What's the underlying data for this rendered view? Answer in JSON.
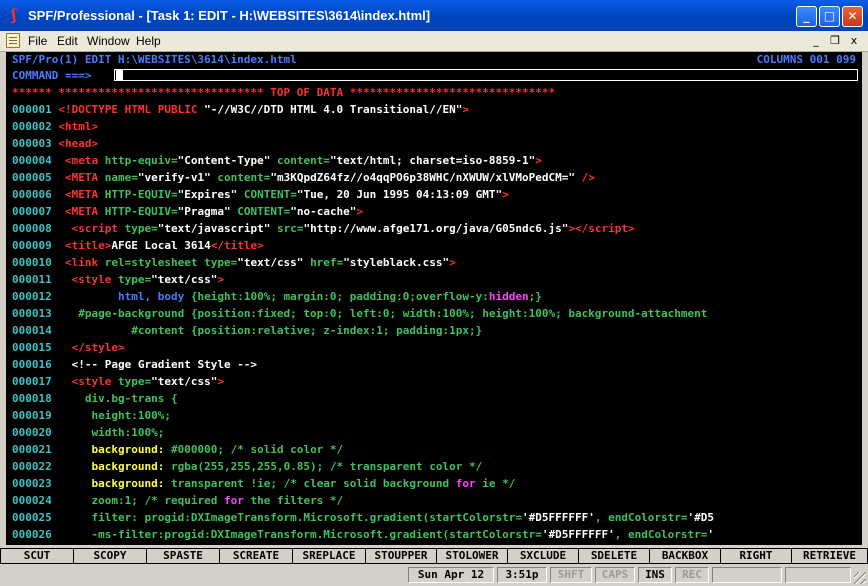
{
  "window": {
    "title": "SPF/Professional - [Task 1: EDIT - H:\\WEBSITES\\3614\\index.html]",
    "app_icon": "spf-icon"
  },
  "menu": {
    "items": [
      "File",
      "Edit",
      "Window",
      "Help"
    ],
    "doc_icon": "document-icon",
    "mdi_buttons": [
      "_",
      "❐",
      "x"
    ]
  },
  "editor": {
    "header_left": "SPF/Pro(1) EDIT H:\\WEBSITES\\3614\\index.html",
    "header_right": "COLUMNS 001 099",
    "command_prompt": "COMMAND ===>",
    "command_value": "",
    "top_marker": "******",
    "top_data": " ******************************* TOP OF DATA *******************************",
    "line_numbers": [
      "000001",
      "000002",
      "000003",
      "000004",
      "000005",
      "000006",
      "000007",
      "000008",
      "000009",
      "000010",
      "000011",
      "000012",
      "000013",
      "000014",
      "000015",
      "000016",
      "000017",
      "000018",
      "000019",
      "000020",
      "000021",
      "000022",
      "000023",
      "000024",
      "000025",
      "000026"
    ]
  },
  "colors": {
    "screen_bg": "#000000",
    "line_number": "#40c0c0",
    "tag": "#ff3030",
    "attribute": "#40c060",
    "string": "#ffffff",
    "css_property": "#ffff40",
    "header": "#4a7cff"
  },
  "function_keys": [
    "SCUT",
    "SCOPY",
    "SPASTE",
    "SCREATE",
    "SREPLACE",
    "STOUPPER",
    "STOLOWER",
    "SXCLUDE",
    "SDELETE",
    "BACKBOX",
    "RIGHT",
    "RETRIEVE"
  ],
  "status": {
    "date": "Sun Apr 12",
    "time": "3:51p",
    "shift": "SHFT",
    "caps": "CAPS",
    "ins": "INS",
    "rec": "REC"
  }
}
